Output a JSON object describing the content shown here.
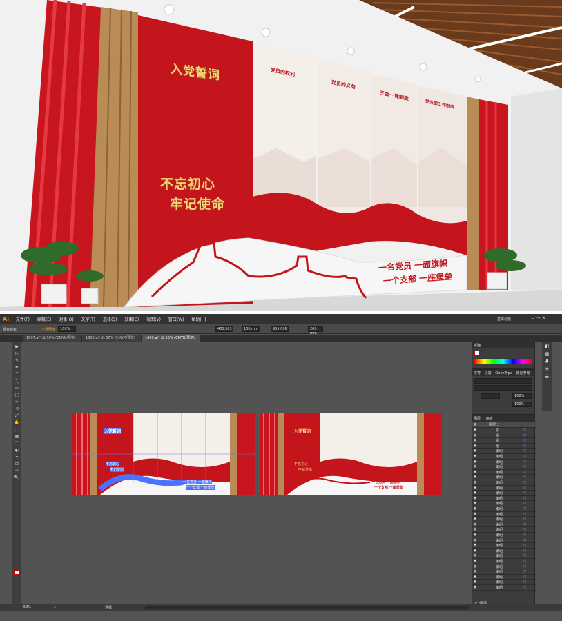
{
  "render": {
    "oath_title": "入党誓词",
    "slogan_line1": "不忘初心",
    "slogan_line2": "牢记使命",
    "panels": [
      "党员的权利",
      "党员的义务",
      "三会一课制度",
      "党支部工作制度"
    ],
    "motto_line1": "一名党员 一面旗帜",
    "motto_line2": "一个支部 一座堡垒"
  },
  "app": {
    "logo": "Ai",
    "menu": [
      "文件(F)",
      "编辑(E)",
      "对象(O)",
      "文字(T)",
      "选择(S)",
      "效果(C)",
      "视图(V)",
      "窗口(W)",
      "帮助(H)"
    ],
    "workspace": "基本功能",
    "control": {
      "label": "混合对象",
      "opacity_label": "不透明度",
      "opacity_value": "100%",
      "x_value": "465.503",
      "w_value": "100 mm",
      "y_value": "955.006",
      "h_value": "200 mm"
    },
    "tabs": [
      "1607.ai* @ 50% (CMYK/预览)",
      "1608.ai* @ 50% (CMYK/预览)",
      "1609.ai* @ 50% (CMYK/预览)"
    ],
    "tools": [
      "▶",
      "▷",
      "✎",
      "✒",
      "T",
      "╲",
      "▭",
      "◯",
      "✂",
      "⟲",
      "⤢",
      "✋",
      "⬚",
      "▦",
      "⛶",
      "◐",
      "✦",
      "⊞",
      "♒",
      "🔍"
    ],
    "artboard": {
      "oath": "入党誓词",
      "slogan1": "不忘初心",
      "slogan2": "牢记使命",
      "motto1": "一名党员 一面旗帜",
      "motto2": "一个支部 一座堡垒"
    },
    "color_panel": {
      "title": "颜色"
    },
    "char_panel": {
      "tabs": [
        "字符",
        "段落",
        "OpenType",
        "路径参考"
      ],
      "size_value": "",
      "tracking_value": "100%",
      "scale_value": "100%"
    },
    "layers_panel": {
      "tabs": [
        "图层",
        "画板"
      ],
      "top_layer": "图层 1",
      "items": [
        "字",
        "组",
        "组",
        "组",
        "编组",
        "编组",
        "编组",
        "编组",
        "编组",
        "编组",
        "编组",
        "编组",
        "编组",
        "编组",
        "编组",
        "编组",
        "编组",
        "编组",
        "编组",
        "编组",
        "编组",
        "编组",
        "编组",
        "编组",
        "编组",
        "编组",
        "编组",
        "编组",
        "编组",
        "编组",
        "编组"
      ],
      "footer": "1个图层"
    },
    "status": {
      "zoom": "50%",
      "page": "1",
      "tool": "选择"
    }
  }
}
